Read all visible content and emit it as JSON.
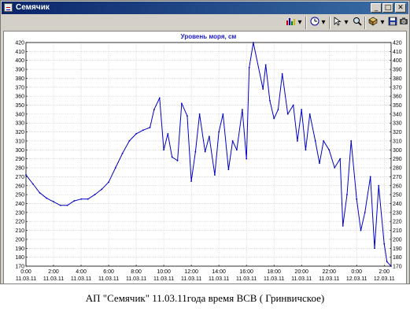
{
  "window": {
    "title": "Семячик",
    "icons": [
      "chart-type-icon",
      "clock-icon",
      "cursor-icon",
      "zoom-icon",
      "export-icon",
      "save-icon",
      "camera-icon"
    ],
    "controls": [
      "_",
      "□",
      "✕"
    ]
  },
  "caption": "АП \"Семячик\" 11.03.11года время ВСВ ( Гринвичское)",
  "chart_data": {
    "type": "line",
    "title": "Уровень моря, см",
    "xlabel": "",
    "ylabel": "",
    "ylim": [
      170,
      420
    ],
    "xlim": [
      0,
      26.5
    ],
    "y_ticks": [
      170,
      180,
      190,
      200,
      210,
      220,
      230,
      240,
      250,
      260,
      270,
      280,
      290,
      300,
      310,
      320,
      330,
      340,
      350,
      360,
      370,
      380,
      390,
      400,
      410,
      420
    ],
    "x_ticks": [
      {
        "x": 0,
        "time": "0:00",
        "date": "11.03.11"
      },
      {
        "x": 2,
        "time": "2:00",
        "date": "11.03.11"
      },
      {
        "x": 4,
        "time": "4:00",
        "date": "11.03.11"
      },
      {
        "x": 6,
        "time": "6:00",
        "date": "11.03.11"
      },
      {
        "x": 8,
        "time": "8:00",
        "date": "11.03.11"
      },
      {
        "x": 10,
        "time": "10:00",
        "date": "11.03.11"
      },
      {
        "x": 12,
        "time": "12:00",
        "date": "11.03.11"
      },
      {
        "x": 14,
        "time": "14:00",
        "date": "11.03.11"
      },
      {
        "x": 16,
        "time": "16:00",
        "date": "11.03.11"
      },
      {
        "x": 18,
        "time": "18:00",
        "date": "11.03.11"
      },
      {
        "x": 20,
        "time": "20:00",
        "date": "11.03.11"
      },
      {
        "x": 22,
        "time": "22:00",
        "date": "11.03.11"
      },
      {
        "x": 24,
        "time": "0:00",
        "date": "12.03.11"
      },
      {
        "x": 26,
        "time": "2:00",
        "date": "12.03.11"
      }
    ],
    "grid": true,
    "color": "#0000c8",
    "series": [
      {
        "name": "",
        "points": [
          [
            0,
            272
          ],
          [
            0.5,
            262
          ],
          [
            1,
            252
          ],
          [
            1.5,
            246
          ],
          [
            2,
            242
          ],
          [
            2.5,
            238
          ],
          [
            3,
            238
          ],
          [
            3.5,
            243
          ],
          [
            4,
            245
          ],
          [
            4.5,
            245
          ],
          [
            5,
            250
          ],
          [
            5.5,
            256
          ],
          [
            6,
            264
          ],
          [
            6.5,
            280
          ],
          [
            7,
            296
          ],
          [
            7.5,
            310
          ],
          [
            8,
            318
          ],
          [
            8.5,
            322
          ],
          [
            9,
            325
          ],
          [
            9.3,
            345
          ],
          [
            9.7,
            358
          ],
          [
            10,
            300
          ],
          [
            10.3,
            318
          ],
          [
            10.6,
            292
          ],
          [
            11,
            288
          ],
          [
            11.3,
            352
          ],
          [
            11.7,
            338
          ],
          [
            12,
            265
          ],
          [
            12.3,
            298
          ],
          [
            12.6,
            340
          ],
          [
            13,
            298
          ],
          [
            13.3,
            315
          ],
          [
            13.7,
            272
          ],
          [
            14,
            320
          ],
          [
            14.3,
            340
          ],
          [
            14.7,
            278
          ],
          [
            15,
            310
          ],
          [
            15.3,
            300
          ],
          [
            15.7,
            345
          ],
          [
            16,
            290
          ],
          [
            16.2,
            392
          ],
          [
            16.5,
            420
          ],
          [
            17.2,
            368
          ],
          [
            17.4,
            395
          ],
          [
            17.7,
            355
          ],
          [
            18,
            335
          ],
          [
            18.3,
            345
          ],
          [
            18.6,
            385
          ],
          [
            19,
            340
          ],
          [
            19.4,
            350
          ],
          [
            19.7,
            310
          ],
          [
            20,
            345
          ],
          [
            20.3,
            300
          ],
          [
            20.6,
            340
          ],
          [
            21,
            310
          ],
          [
            21.3,
            285
          ],
          [
            21.6,
            310
          ],
          [
            22,
            300
          ],
          [
            22.4,
            280
          ],
          [
            22.8,
            290
          ],
          [
            23,
            215
          ],
          [
            23.3,
            250
          ],
          [
            23.6,
            310
          ],
          [
            24,
            245
          ],
          [
            24.3,
            210
          ],
          [
            24.6,
            230
          ],
          [
            25,
            270
          ],
          [
            25.3,
            190
          ],
          [
            25.6,
            260
          ],
          [
            26,
            195
          ],
          [
            26.2,
            175
          ],
          [
            26.5,
            170
          ]
        ]
      }
    ]
  }
}
